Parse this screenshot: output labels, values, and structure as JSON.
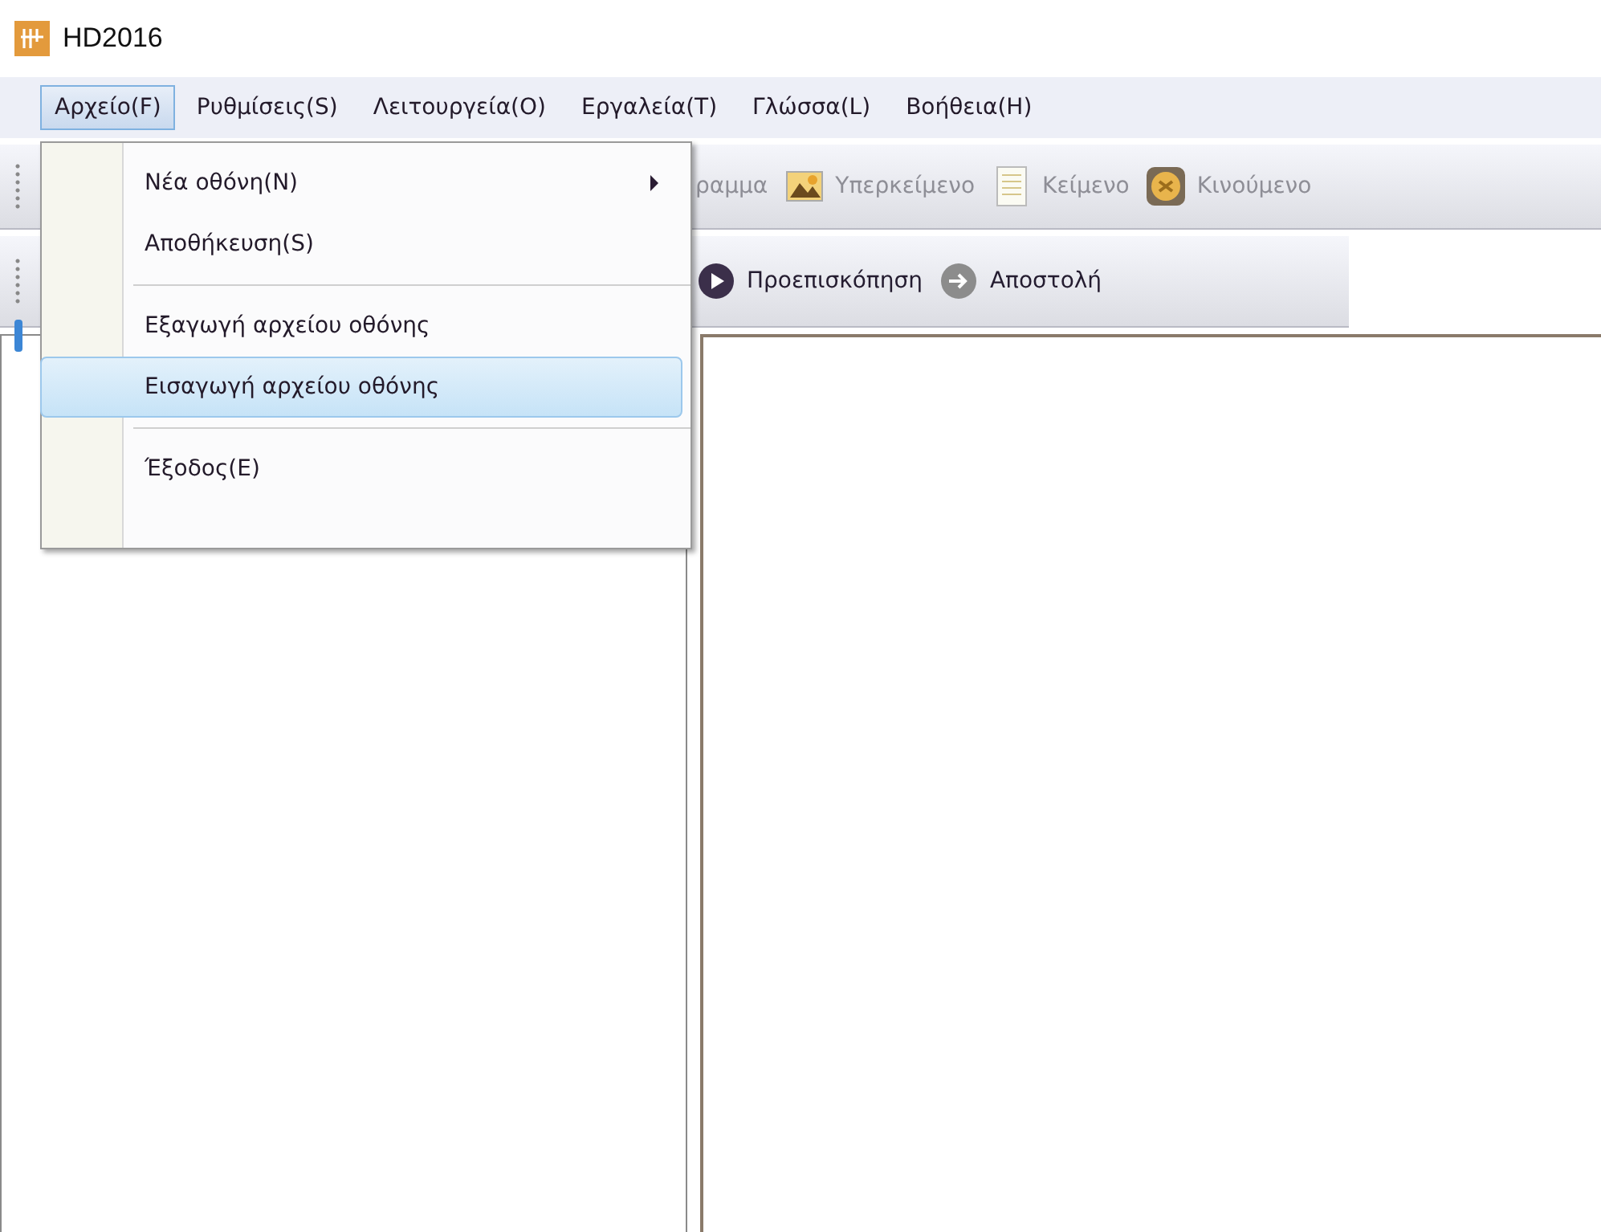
{
  "window": {
    "title": "HD2016"
  },
  "menubar": [
    {
      "label": "Αρχείο(F)",
      "selected": true
    },
    {
      "label": "Ρυθμίσεις(S)",
      "selected": false
    },
    {
      "label": "Λειτουργεία(O)",
      "selected": false
    },
    {
      "label": "Εργαλεία(T)",
      "selected": false
    },
    {
      "label": "Γλώσσα(L)",
      "selected": false
    },
    {
      "label": "Βοήθεια(H)",
      "selected": false
    }
  ],
  "toolbar_1": [
    {
      "label": "ραμμα",
      "kind": "none"
    },
    {
      "label": "Υπερκείμενο",
      "kind": "picture"
    },
    {
      "label": "Κείμενο",
      "kind": "text"
    },
    {
      "label": "Κινούμενο",
      "kind": "animation"
    }
  ],
  "toolbar_2": [
    {
      "label": "Προεπισκόπηση",
      "kind": "play"
    },
    {
      "label": "Αποστολή",
      "kind": "send"
    }
  ],
  "menu": [
    {
      "kind": "item",
      "label": "Νέα οθόνη(N)",
      "submenu": true,
      "selected": false
    },
    {
      "kind": "item",
      "label": "Αποθήκευση(S)",
      "submenu": false,
      "selected": false
    },
    {
      "kind": "separator"
    },
    {
      "kind": "item",
      "label": "Εξαγωγή αρχείου οθόνης",
      "submenu": false,
      "selected": false
    },
    {
      "kind": "item",
      "label": "Εισαγωγή αρχείου οθόνης",
      "submenu": false,
      "selected": true
    },
    {
      "kind": "separator"
    },
    {
      "kind": "item",
      "label": "Έξοδος(E)",
      "submenu": false,
      "selected": false
    }
  ]
}
